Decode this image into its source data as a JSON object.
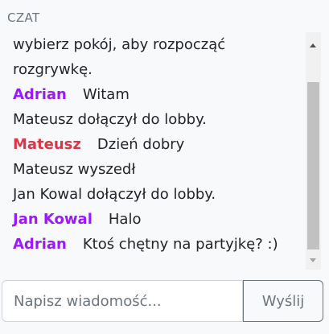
{
  "chat": {
    "header": "CZAT",
    "messages": [
      {
        "text": "wybierz pokój, aby rozpocząć rozgrywkę."
      },
      {
        "nick": "Adrian",
        "nick_color": "#9b19f5",
        "text": "Witam"
      },
      {
        "text": "Mateusz dołączył do lobby."
      },
      {
        "nick": "Mateusz",
        "nick_color": "#dc3545",
        "text": "Dzień dobry"
      },
      {
        "text": "Mateusz wyszedł"
      },
      {
        "text": "Jan Kowal dołączył do lobby."
      },
      {
        "nick": "Jan Kowal",
        "nick_color": "#9b19f5",
        "text": "Halo"
      },
      {
        "nick": "Adrian",
        "nick_color": "#9b19f5",
        "text": "Ktoś chętny na partyjkę? :)"
      }
    ]
  },
  "composer": {
    "placeholder": "Napisz wiadomość...",
    "value": "",
    "send_label": "Wyślij"
  },
  "colors": {
    "nick_purple": "#9b19f5",
    "nick_red": "#dc3545",
    "muted": "#6c757d"
  }
}
